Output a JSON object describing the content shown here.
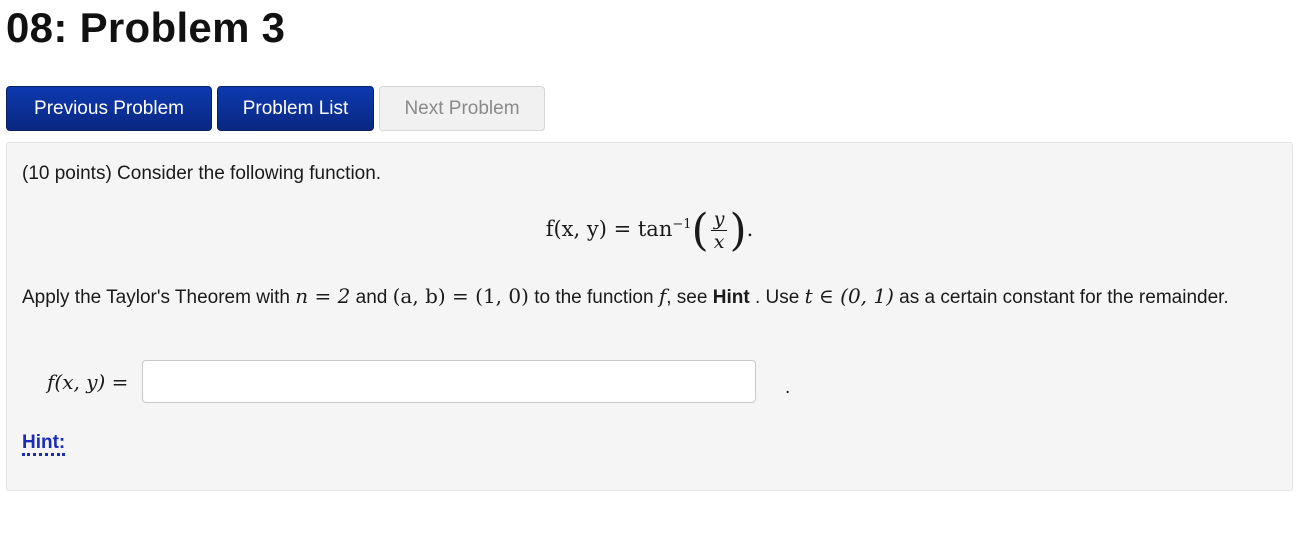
{
  "page": {
    "title": "08: Problem 3"
  },
  "nav": {
    "previous_label": "Previous Problem",
    "list_label": "Problem List",
    "next_label": "Next Problem"
  },
  "problem": {
    "intro": "(10 points) Consider the following function.",
    "function_lhs": "f(x, y) = tan",
    "function_exponent": "−1",
    "fraction_numerator": "y",
    "fraction_denominator": "x",
    "function_end": ".",
    "instruction_parts": {
      "p1": "Apply the Taylor's Theorem with ",
      "n_eq": "n = 2",
      "p2": " and ",
      "ab_eq": "(a, b) = (1, 0)",
      "p3": " to the function ",
      "f": "f",
      "p4": ", see ",
      "hint_word": "Hint",
      "p5": " . Use ",
      "t_in": "t ∈ (0, 1)",
      "p6": " as a certain constant for the remainder."
    },
    "answer_label": "f(x, y) =",
    "answer_value": "",
    "answer_trailing": ".",
    "hint_link": "Hint:"
  },
  "colors": {
    "button_active": "#0a2781",
    "button_disabled": "#f1f1f1",
    "panel_bg": "#f5f5f5",
    "hint_link": "#1a2db8"
  }
}
